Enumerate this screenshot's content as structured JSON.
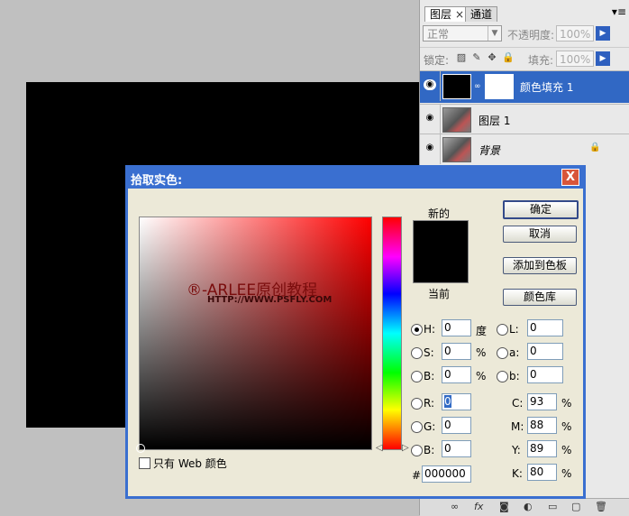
{
  "panel": {
    "tabs": [
      {
        "label": "图层",
        "close": "×"
      },
      {
        "label": "通道"
      }
    ],
    "menu_icon": "▾≡",
    "blend_mode": "正常",
    "opacity_label": "不透明度:",
    "opacity_value": "100%",
    "lock_label": "锁定:",
    "lock_icons": [
      "▨",
      "✎",
      "✥",
      "🔒"
    ],
    "fill_label": "填充:",
    "fill_value": "100%",
    "layers": [
      {
        "name": "颜色填充 1",
        "selected": true
      },
      {
        "name": "图层 1",
        "selected": false
      },
      {
        "name": "背景",
        "selected": false,
        "locked": true
      }
    ],
    "bottom_icons": [
      "∞",
      "fx",
      "◙",
      "◐",
      "▭",
      "▢",
      "🗑"
    ]
  },
  "dialog": {
    "title": "拾取实色:",
    "close": "X",
    "watermark_line1": "®-ARLEE原创教程",
    "watermark_line2": "HTTP://WWW.PSFLY.COM",
    "new_label": "新的",
    "current_label": "当前",
    "buttons": {
      "ok": "确定",
      "cancel": "取消",
      "add_swatch": "添加到色板",
      "library": "颜色库"
    },
    "web_only": "只有 Web 颜色",
    "fields": {
      "H": {
        "label": "H:",
        "value": "0",
        "unit": "度",
        "selected": true
      },
      "S": {
        "label": "S:",
        "value": "0",
        "unit": "%"
      },
      "Bv": {
        "label": "B:",
        "value": "0",
        "unit": "%"
      },
      "R": {
        "label": "R:",
        "value": "0"
      },
      "G": {
        "label": "G:",
        "value": "0"
      },
      "B": {
        "label": "B:",
        "value": "0"
      },
      "L": {
        "label": "L:",
        "value": "0"
      },
      "a": {
        "label": "a:",
        "value": "0"
      },
      "b": {
        "label": "b:",
        "value": "0"
      },
      "C": {
        "label": "C:",
        "value": "93",
        "unit": "%"
      },
      "M": {
        "label": "M:",
        "value": "88",
        "unit": "%"
      },
      "Y": {
        "label": "Y:",
        "value": "89",
        "unit": "%"
      },
      "K": {
        "label": "K:",
        "value": "80",
        "unit": "%"
      }
    },
    "hex_label": "#",
    "hex_value": "000000",
    "new_color": "#000000"
  }
}
